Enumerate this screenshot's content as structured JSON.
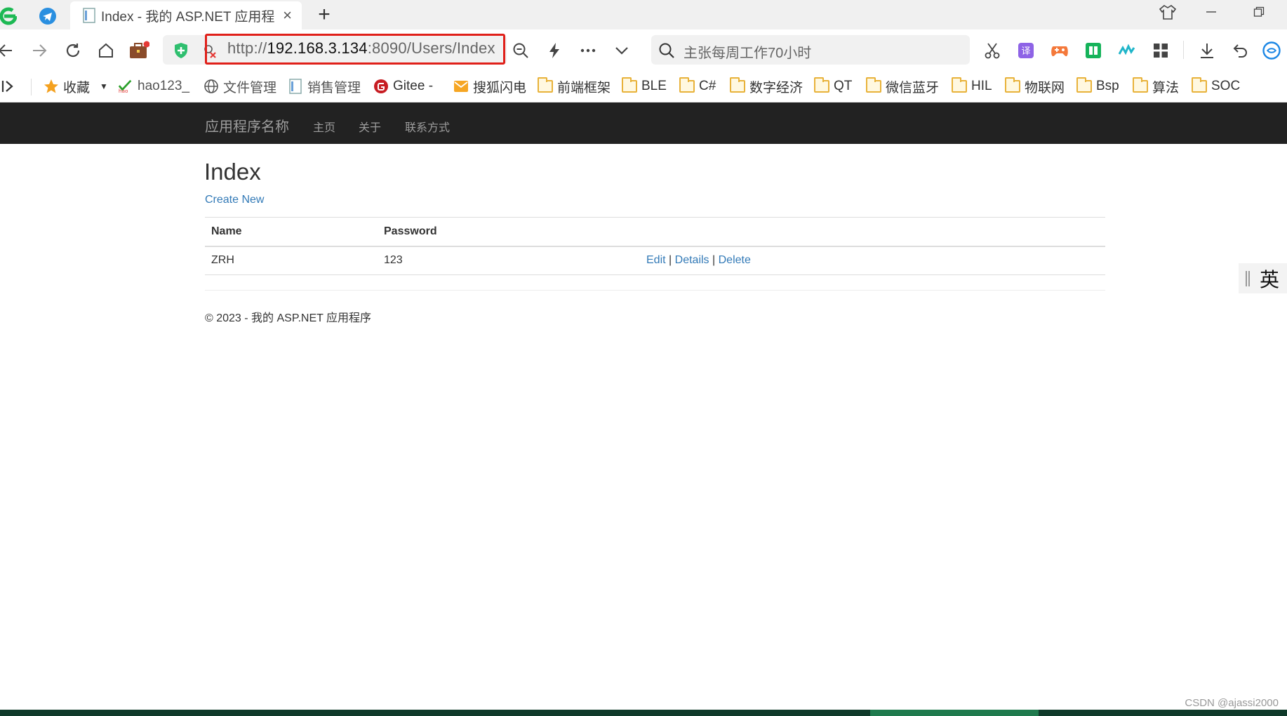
{
  "browser": {
    "tab": {
      "title": "Index - 我的 ASP.NET 应用程",
      "close_glyph": "×"
    },
    "new_tab_glyph": "+",
    "address": {
      "scheme": "http://",
      "host": "192.168.3.134",
      "rest": ":8090/Users/Index"
    },
    "search_placeholder": "主张每周工作70小时",
    "highlight_color": "#e0201a"
  },
  "bookmarks": [
    {
      "label": "收藏",
      "icon": "star-icon"
    },
    {
      "label": "hao123_",
      "icon": "hao123-icon"
    },
    {
      "label": "文件管理",
      "icon": "globe-icon"
    },
    {
      "label": "销售管理",
      "icon": "page-icon"
    },
    {
      "label": "Gitee -",
      "icon": "gitee-icon"
    },
    {
      "label": "搜狐闪电",
      "icon": "mail-icon"
    },
    {
      "label": "前端框架",
      "icon": "folder-icon"
    },
    {
      "label": "BLE",
      "icon": "folder-icon"
    },
    {
      "label": "C#",
      "icon": "folder-icon"
    },
    {
      "label": "数字经济",
      "icon": "folder-icon"
    },
    {
      "label": "QT",
      "icon": "folder-icon"
    },
    {
      "label": "微信蓝牙",
      "icon": "folder-icon"
    },
    {
      "label": "HIL",
      "icon": "folder-icon"
    },
    {
      "label": "物联网",
      "icon": "folder-icon"
    },
    {
      "label": "Bsp",
      "icon": "folder-icon"
    },
    {
      "label": "算法",
      "icon": "folder-icon"
    },
    {
      "label": "SOC",
      "icon": "folder-icon"
    }
  ],
  "site": {
    "brand": "应用程序名称",
    "nav": [
      "主页",
      "关于",
      "联系方式"
    ],
    "heading": "Index",
    "create_new": "Create New",
    "table": {
      "headers": [
        "Name",
        "Password"
      ],
      "rows": [
        {
          "name": "ZRH",
          "password": "123",
          "edit": "Edit",
          "details": "Details",
          "delete": "Delete",
          "sep": "|"
        }
      ]
    },
    "footer": "© 2023 - 我的 ASP.NET 应用程序",
    "link_color": "#337ab7",
    "navbar_color": "#222222"
  },
  "ime": {
    "label": "英"
  },
  "watermark": "CSDN @ajassi2000"
}
